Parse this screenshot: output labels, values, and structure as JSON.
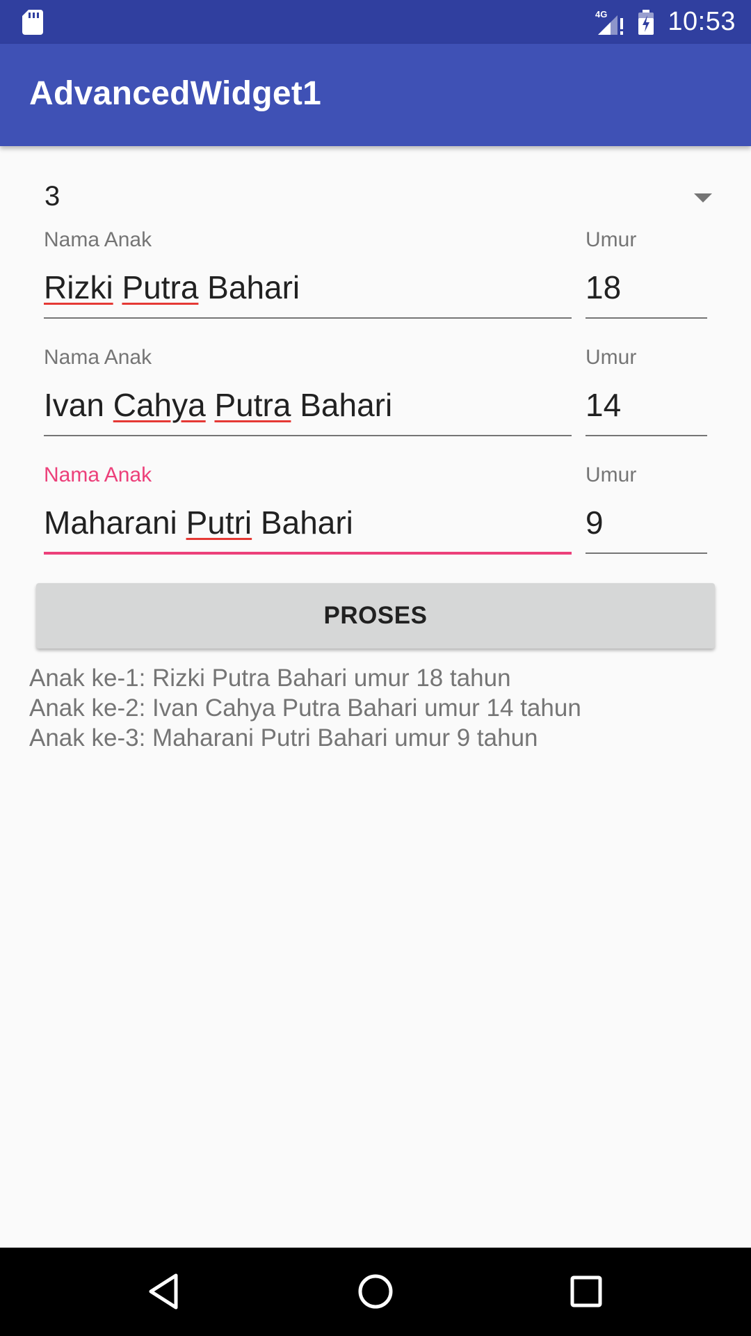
{
  "status_bar": {
    "network": "4G",
    "time": "10:53",
    "icons": [
      "sd-card-icon",
      "signal-icon",
      "battery-icon"
    ]
  },
  "app_bar": {
    "title": "AdvancedWidget1"
  },
  "spinner": {
    "selected_value": "3"
  },
  "children": [
    {
      "name_label": "Nama Anak",
      "name_parts": [
        {
          "text": "Rizki",
          "misspelled": true
        },
        {
          "text": " ",
          "misspelled": false
        },
        {
          "text": "Putra",
          "misspelled": true
        },
        {
          "text": " Bahari",
          "misspelled": false
        }
      ],
      "age_label": "Umur",
      "age_value": "18",
      "focused": false
    },
    {
      "name_label": "Nama Anak",
      "name_parts": [
        {
          "text": "Ivan ",
          "misspelled": false
        },
        {
          "text": "Cahya",
          "misspelled": true
        },
        {
          "text": " ",
          "misspelled": false
        },
        {
          "text": "Putra",
          "misspelled": true
        },
        {
          "text": " Bahari",
          "misspelled": false
        }
      ],
      "age_label": "Umur",
      "age_value": "14",
      "focused": false
    },
    {
      "name_label": "Nama Anak",
      "name_parts": [
        {
          "text": "Maharani ",
          "misspelled": false
        },
        {
          "text": "Putri",
          "misspelled": true
        },
        {
          "text": " Bahari",
          "misspelled": false
        }
      ],
      "age_label": "Umur",
      "age_value": "9",
      "focused": true
    }
  ],
  "button": {
    "label": "PROSES"
  },
  "result": {
    "lines": [
      "Anak ke-1: Rizki Putra Bahari umur 18 tahun",
      "Anak ke-2: Ivan Cahya Putra Bahari umur 14 tahun",
      "Anak ke-3: Maharani Putri Bahari umur 9 tahun"
    ]
  },
  "nav_bar": {
    "buttons": [
      "back-icon",
      "home-icon",
      "recents-icon"
    ]
  },
  "colors": {
    "primary_dark": "#303f9f",
    "primary": "#3f51b5",
    "accent": "#ec407a",
    "spellcheck": "#e53935",
    "background": "#fafafa"
  }
}
